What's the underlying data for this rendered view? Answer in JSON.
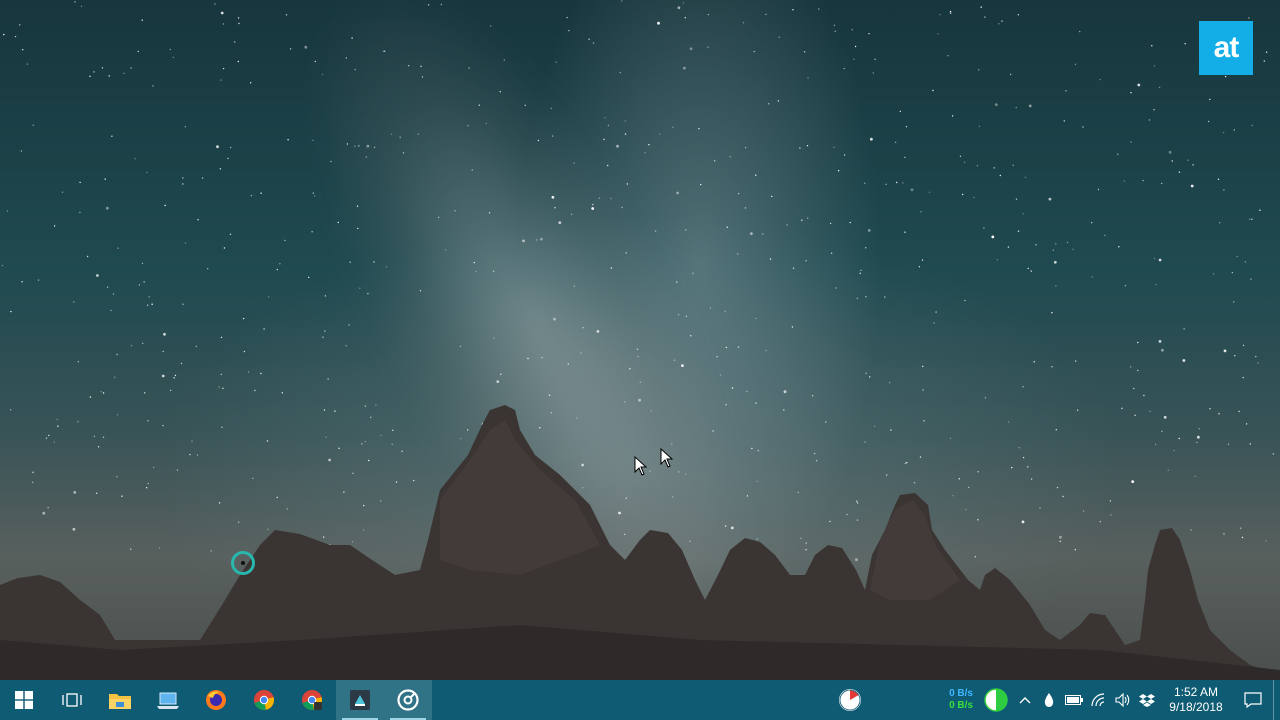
{
  "watermark": {
    "logo_text": "at",
    "color": "#13aee8"
  },
  "taskbar": {
    "background": "#0e5b73",
    "start_icon": "windows-logo-icon",
    "apps": [
      {
        "name": "task-view",
        "icon": "task-view-icon"
      },
      {
        "name": "file-explorer",
        "icon": "folder-icon"
      },
      {
        "name": "this-pc",
        "icon": "laptop-icon"
      },
      {
        "name": "firefox",
        "icon": "firefox-icon"
      },
      {
        "name": "chrome",
        "icon": "chrome-icon"
      },
      {
        "name": "chrome-profile",
        "icon": "chrome-icon"
      },
      {
        "name": "filmora",
        "icon": "filmora-icon",
        "active": true
      },
      {
        "name": "groove",
        "icon": "groove-music-icon",
        "active": true
      }
    ],
    "tray": {
      "cpu_icon": "cpu-meter-icon",
      "net_up": "0 B/s",
      "net_down": "0 B/s",
      "indicator_icon": "green-circle-icon",
      "overflow_icon": "chevron-up-icon",
      "icons": [
        "droplet-icon",
        "battery-icon",
        "wifi-icon",
        "volume-icon",
        "dropbox-icon"
      ],
      "time": "1:52 AM",
      "date": "9/18/2018",
      "notification_icon": "action-center-icon"
    }
  }
}
